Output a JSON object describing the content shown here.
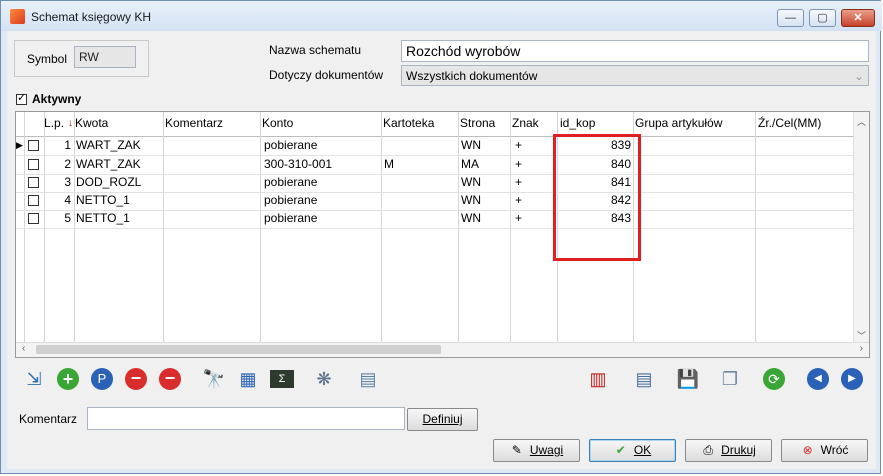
{
  "window": {
    "title": "Schemat księgowy KH",
    "controls": [
      "minimize-icon",
      "maximize-icon",
      "close-icon"
    ]
  },
  "form": {
    "symbol_label": "Symbol",
    "symbol_value": "RW",
    "nazwa_label": "Nazwa schematu",
    "nazwa_value": "Rozchód wyrobów",
    "dotyczy_label": "Dotyczy dokumentów",
    "dotyczy_value": "Wszystkich dokumentów",
    "aktywny_label": "Aktywny",
    "aktywny_checked": true
  },
  "grid": {
    "headers": {
      "lp": "L.p.",
      "kwota": "Kwota",
      "komentarz": "Komentarz",
      "konto": "Konto",
      "kartoteka": "Kartoteka",
      "strona": "Strona",
      "znak": "Znak",
      "id_kop": "id_kop",
      "grupa": "Grupa artykułów",
      "zr": "Źr./Cel(MM)"
    },
    "rows": [
      {
        "lp": "1",
        "kwota": "WART_ZAK",
        "komentarz": "",
        "konto": "pobierane",
        "kartoteka": "",
        "strona": "WN",
        "znak": "+",
        "id_kop": "839"
      },
      {
        "lp": "2",
        "kwota": "WART_ZAK",
        "komentarz": "",
        "konto": "300-310-001",
        "kartoteka": "M",
        "strona": "MA",
        "znak": "+",
        "id_kop": "840"
      },
      {
        "lp": "3",
        "kwota": "DOD_ROZL",
        "komentarz": "",
        "konto": "pobierane",
        "kartoteka": "",
        "strona": "WN",
        "znak": "+",
        "id_kop": "841"
      },
      {
        "lp": "4",
        "kwota": "NETTO_1",
        "komentarz": "",
        "konto": "pobierane",
        "kartoteka": "",
        "strona": "WN",
        "znak": "+",
        "id_kop": "842"
      },
      {
        "lp": "5",
        "kwota": "NETTO_1",
        "komentarz": "",
        "konto": "pobierane",
        "kartoteka": "",
        "strona": "WN",
        "znak": "+",
        "id_kop": "843"
      }
    ]
  },
  "toolbar_icons": [
    "import-icon",
    "add-icon",
    "edit-icon",
    "delete-icon",
    "delete-confirm-icon",
    "binoculars-icon",
    "table-icon",
    "formula-icon",
    "network-icon",
    "display-icon",
    "chart-icon",
    "document-icon",
    "save-icon",
    "windows-icon",
    "refresh-icon",
    "previous-icon",
    "next-icon"
  ],
  "komentarz": {
    "label": "Komentarz",
    "value": "",
    "define_button": "Definiuj"
  },
  "buttons": {
    "uwagi": "Uwagi",
    "ok": "OK",
    "drukuj": "Drukuj",
    "wroc": "Wróć"
  }
}
